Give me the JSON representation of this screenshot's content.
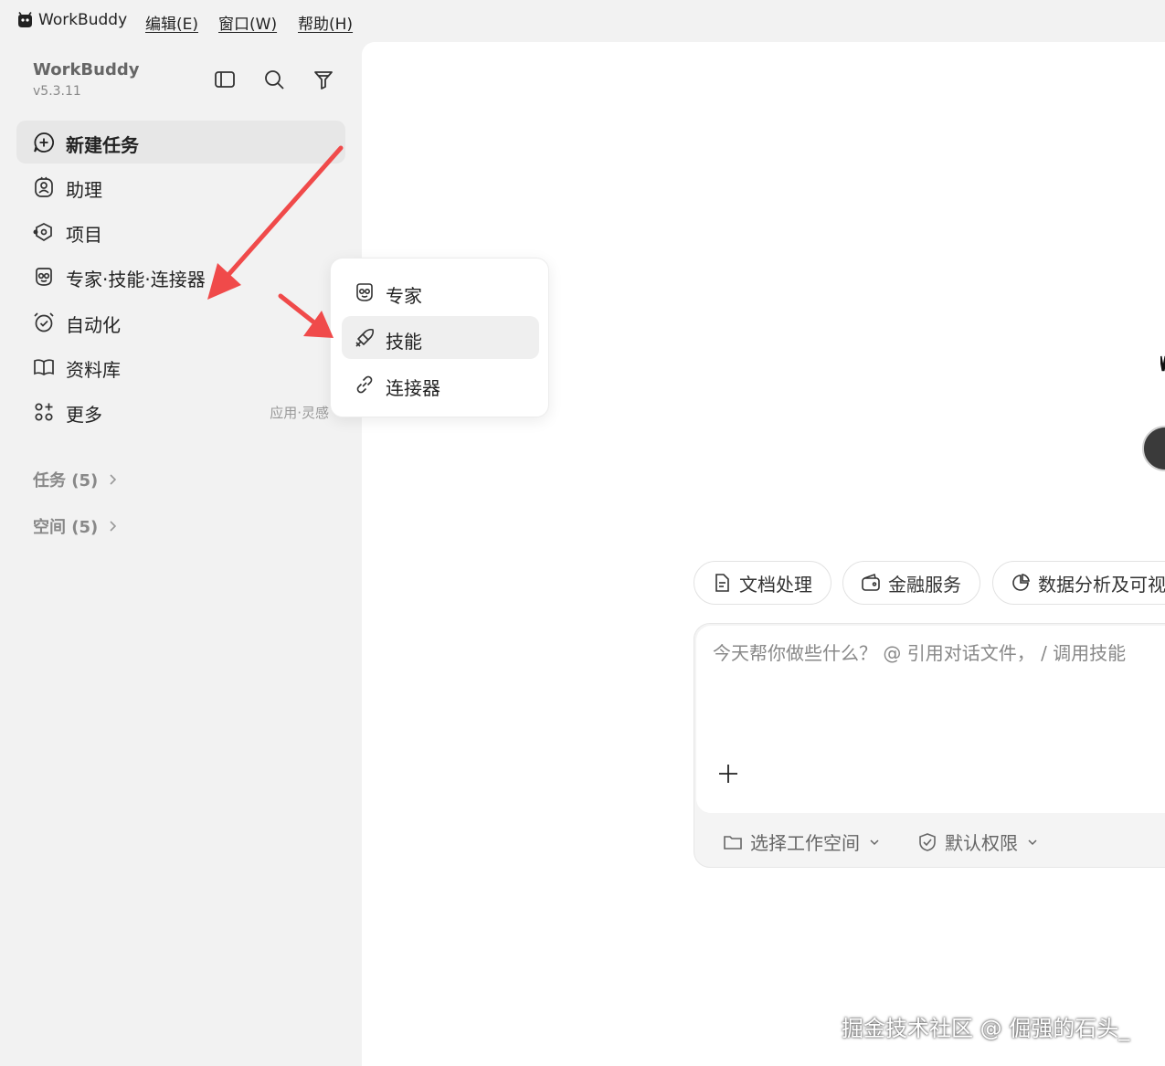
{
  "menubar": {
    "app_name": "WorkBuddy",
    "items": [
      "编辑(E)",
      "窗口(W)",
      "帮助(H)"
    ]
  },
  "sidebar": {
    "brand_name": "WorkBuddy",
    "version": "v5.3.11",
    "nav": [
      {
        "label": "新建任务",
        "icon": "chat-plus-icon"
      },
      {
        "label": "助理",
        "icon": "assistant-icon"
      },
      {
        "label": "项目",
        "icon": "project-icon"
      },
      {
        "label": "专家·技能·连接器",
        "icon": "expert-icon"
      },
      {
        "label": "自动化",
        "icon": "alarm-icon"
      },
      {
        "label": "资料库",
        "icon": "book-icon"
      },
      {
        "label": "更多",
        "icon": "apps-icon",
        "hint": "应用·灵感"
      }
    ],
    "sections": [
      {
        "label": "任务 (5)"
      },
      {
        "label": "空间 (5)"
      }
    ]
  },
  "popup": {
    "items": [
      {
        "label": "专家",
        "icon": "expert-icon"
      },
      {
        "label": "技能",
        "icon": "skill-icon"
      },
      {
        "label": "连接器",
        "icon": "link-icon"
      }
    ]
  },
  "main": {
    "pills": [
      {
        "label": "文档处理",
        "icon": "document-icon"
      },
      {
        "label": "金融服务",
        "icon": "wallet-icon"
      },
      {
        "label": "数据分析及可视",
        "icon": "pie-chart-icon"
      }
    ],
    "composer": {
      "placeholder": "今天帮你做些什么？ @ 引用对话文件， / 调用技能",
      "workspace_label": "选择工作空间",
      "permission_label": "默认权限"
    }
  },
  "watermark": "掘金技术社区 @ 倔强的石头_",
  "colors": {
    "sidebar_bg": "#f2f2f2",
    "active_bg": "#e7e7e7",
    "arrow": "#f04a4a"
  }
}
